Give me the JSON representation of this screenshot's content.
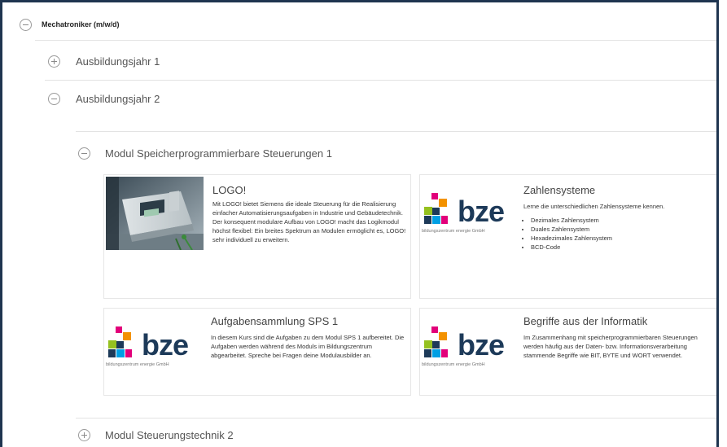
{
  "accordion": {
    "root": {
      "label": "Mechatroniker (m/w/d)"
    },
    "year1": {
      "label": "Ausbildungsjahr 1"
    },
    "year2": {
      "label": "Ausbildungsjahr 2"
    },
    "module1": {
      "label": "Modul Speicherprogrammierbare Steuerungen 1"
    },
    "module2": {
      "label": "Modul Steuerungstechnik 2"
    }
  },
  "cards": [
    {
      "title": "LOGO!",
      "description": "Mit LOGO! bietet Siemens die ideale Steuerung für die Realisierung einfacher Automatisierungsaufgaben in Industrie und Gebäudetechnik. Der konsequent modulare Aufbau von LOGO! macht das Logikmodul höchst flexibel: Ein breites Spektrum an Modulen ermöglicht es, LOGO! sehr individuell zu erweitern."
    },
    {
      "title": "Zahlensysteme",
      "description": "Lerne die unterschiedlichen Zahlensysteme kennen.",
      "bullets": [
        "Dezimales Zahlensystem",
        "Duales Zahlensystem",
        "Hexadezimales Zahlensystem",
        "BCD-Code"
      ]
    },
    {
      "title": "Aufgabensammlung SPS 1",
      "description": "In diesem Kurs sind die Aufgaben zu dem Modul SPS 1 aufbereitet. Die Aufgaben werden während des Moduls im Bildungszentrum abgearbeitet. Spreche bei Fragen deine Modulausbilder an."
    },
    {
      "title": "Begriffe aus der Informatik",
      "description": "Im Zusammenhang mit speicherprogrammierbaren Steuerungen werden häufig aus der Daten- bzw. Informationsverarbeitung stammende Begriffe wie BIT, BYTE und WORT verwendet."
    }
  ],
  "logo": {
    "word": "bze",
    "subtitle": "bildungszentrum energie GmbH",
    "colors": [
      "#e2007a",
      "#f39200",
      "#95c11f",
      "#1d3a59",
      "#009fe3"
    ]
  }
}
